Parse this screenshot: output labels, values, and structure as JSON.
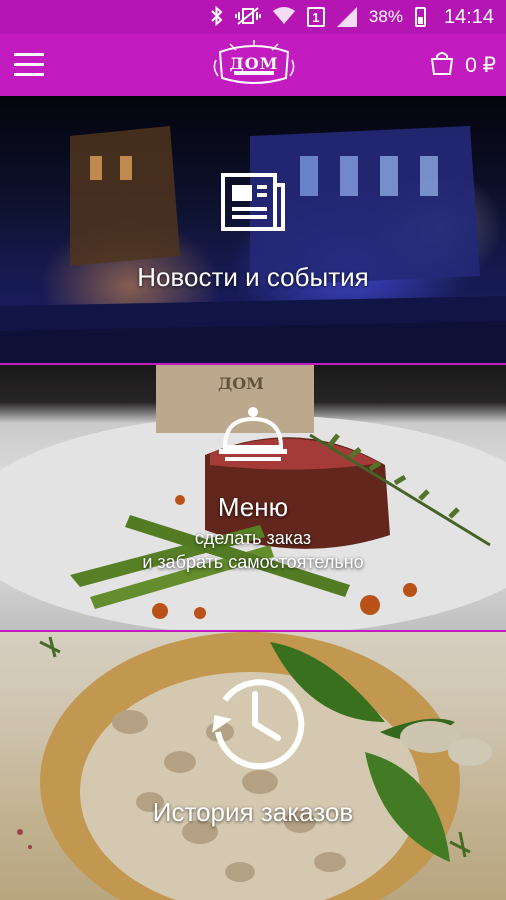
{
  "status_bar": {
    "battery": "38%",
    "time": "14:14",
    "sim": "1",
    "icons": [
      "bluetooth-icon",
      "vibrate-icon",
      "wifi-icon",
      "sim-icon",
      "signal-icon",
      "battery-icon"
    ]
  },
  "app_bar": {
    "logo_text": "ДОМ",
    "cart_count": "0",
    "currency": "₽",
    "accent": "#c21bc0",
    "status_color": "#b516b3"
  },
  "tiles": [
    {
      "title": "Новости и события",
      "subtitle": "",
      "icon": "newspaper-icon"
    },
    {
      "title": "Меню",
      "subtitle_line1": "сделать заказ",
      "subtitle_line2": "и забрать самостоятельно",
      "icon": "cloche-icon"
    },
    {
      "title": "История заказов",
      "icon": "history-clock-icon"
    }
  ],
  "decor": {
    "menu_card_text": "ДОМ"
  }
}
